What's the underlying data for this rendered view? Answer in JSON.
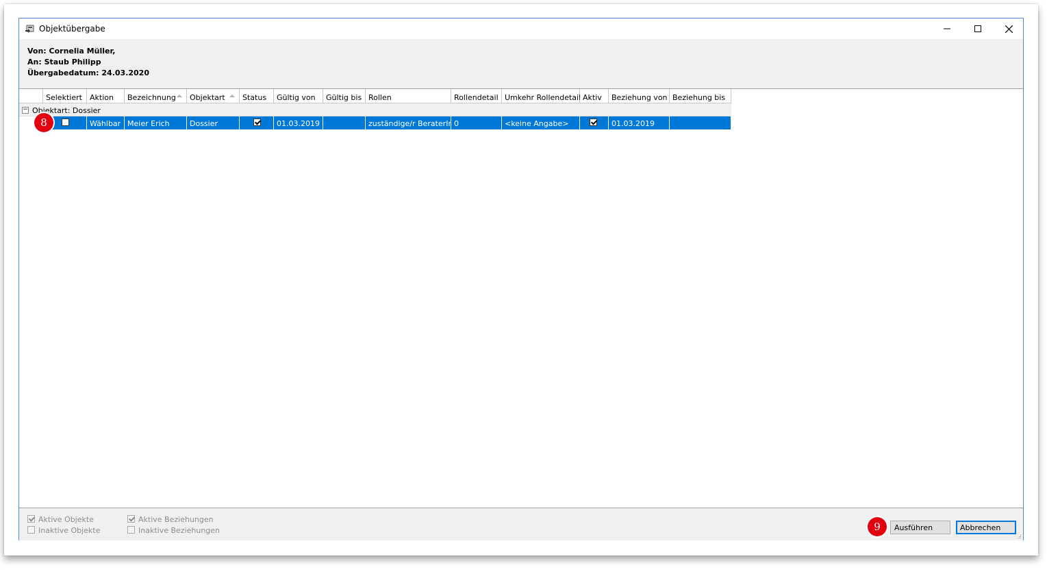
{
  "window": {
    "title": "Objektübergabe"
  },
  "info": {
    "from": "Von: Cornelia Müller,",
    "to": "An: Staub Philipp",
    "date": "Übergabedatum: 24.03.2020"
  },
  "table": {
    "columns": [
      "Selektiert",
      "Aktion",
      "Bezeichnung",
      "Objektart",
      "Status",
      "Gültig von",
      "Gültig bis",
      "Rollen",
      "Rollendetail",
      "Umkehr Rollendetail",
      "Aktiv",
      "Beziehung von",
      "Beziehung bis"
    ],
    "group": {
      "label": "Objektart:  Dossier",
      "toggle": "−"
    },
    "rows": [
      {
        "selektiert": false,
        "aktion": "Wählbar",
        "bezeichnung": "Meier Erich",
        "objektart": "Dossier",
        "status": true,
        "gueltig_von": "01.03.2019",
        "gueltig_bis": "",
        "rollen": "zuständige/r BeraterIn",
        "rollendetail": "0",
        "umkehr_rollendetail": "<keine Angabe>",
        "aktiv": true,
        "beziehung_von": "01.03.2019",
        "beziehung_bis": ""
      }
    ]
  },
  "filters": {
    "aktive_objekte": {
      "label": "Aktive Objekte",
      "checked": true
    },
    "inaktive_objekte": {
      "label": "Inaktive Objekte",
      "checked": false
    },
    "aktive_beziehungen": {
      "label": "Aktive Beziehungen",
      "checked": true
    },
    "inaktive_beziehungen": {
      "label": "Inaktive Beziehungen",
      "checked": false
    }
  },
  "buttons": {
    "execute": "Ausführen",
    "cancel": "Abbrechen"
  },
  "callouts": {
    "row_marker": "8",
    "button_marker": "9",
    "color": "#e3000f"
  },
  "colors": {
    "selection": "#0078d7",
    "accent_border": "#4a90d9"
  }
}
